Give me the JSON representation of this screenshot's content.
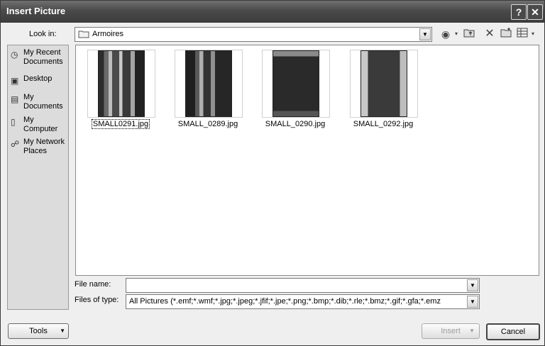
{
  "window": {
    "title": "Insert Picture"
  },
  "titlebar": {
    "help_label": "?",
    "close_label": "✕"
  },
  "lookin": {
    "label": "Look in:",
    "value": "Armoires"
  },
  "places": [
    {
      "label": "My Recent Documents",
      "icon": "recent-documents-icon"
    },
    {
      "label": "Desktop",
      "icon": "desktop-icon"
    },
    {
      "label": "My Documents",
      "icon": "my-documents-icon"
    },
    {
      "label": "My Computer",
      "icon": "my-computer-icon"
    },
    {
      "label": "My Network Places",
      "icon": "network-places-icon"
    }
  ],
  "files": [
    {
      "name": "SMALL0291.jpg",
      "selected": true
    },
    {
      "name": "SMALL_0289.jpg",
      "selected": false
    },
    {
      "name": "SMALL_0290.jpg",
      "selected": false
    },
    {
      "name": "SMALL_0292.jpg",
      "selected": false
    }
  ],
  "filename": {
    "label": "File name:",
    "value": ""
  },
  "filetype": {
    "label": "Files of type:",
    "value": "All Pictures (*.emf;*.wmf;*.jpg;*.jpeg;*.jfif;*.jpe;*.png;*.bmp;*.dib;*.rle;*.bmz;*.gif;*.gfa;*.emz"
  },
  "buttons": {
    "tools": "Tools",
    "insert": "Insert",
    "cancel": "Cancel"
  }
}
